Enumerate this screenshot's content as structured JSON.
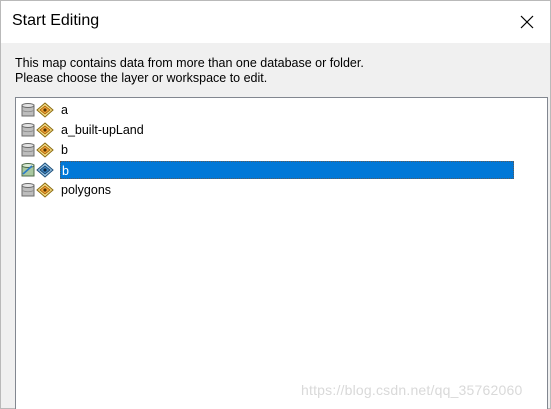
{
  "window": {
    "title": "Start Editing",
    "close_icon": "close-icon"
  },
  "message": {
    "line1": "This map contains data from more than one database or folder.",
    "line2": "Please choose the layer or workspace to edit."
  },
  "layers": [
    {
      "label": "a",
      "icon": "database-icon",
      "layer_icon": "feature-class-icon",
      "selected": false
    },
    {
      "label": "a_built-upLand",
      "icon": "database-icon",
      "layer_icon": "feature-class-icon",
      "selected": false
    },
    {
      "label": "b",
      "icon": "database-icon",
      "layer_icon": "feature-class-icon",
      "selected": false
    },
    {
      "label": "b",
      "icon": "database-icon",
      "layer_icon": "feature-class-icon",
      "selected": true
    },
    {
      "label": "polygons",
      "icon": "database-icon",
      "layer_icon": "feature-class-icon",
      "selected": false
    }
  ],
  "watermark": "https://blog.csdn.net/qq_35762060",
  "colors": {
    "selection": "#0078d7",
    "dialog_bg": "#f0f0f0",
    "list_bg": "#ffffff"
  }
}
